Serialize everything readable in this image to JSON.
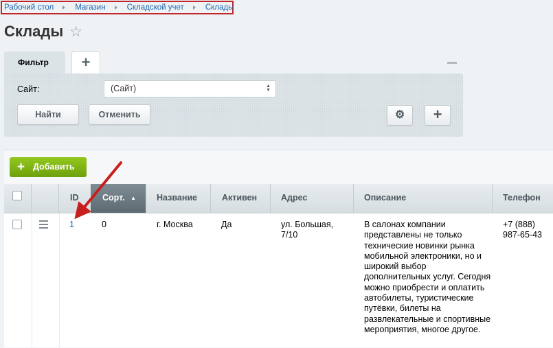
{
  "breadcrumb": [
    "Рабочий стол",
    "Магазин",
    "Складской учет",
    "Склады"
  ],
  "page_title": "Склады",
  "filter": {
    "tab_label": "Фильтр",
    "site_label": "Сайт:",
    "site_value": "(Сайт)",
    "find_button": "Найти",
    "cancel_button": "Отменить"
  },
  "list": {
    "add_button": "Добавить",
    "columns": [
      "ID",
      "Сорт.",
      "Название",
      "Активен",
      "Адрес",
      "Описание",
      "Телефон"
    ],
    "sorted_column": "Сорт.",
    "rows": [
      {
        "id": "1",
        "sort": "0",
        "name": "г. Москва",
        "active": "Да",
        "address": "ул. Большая, 7/10",
        "description": "В салонах компании представлены не только технические новинки рынка мобильной электроники, но и широкий выбор дополнительных услуг. Сегодня можно приобрести и оплатить автобилеты, туристические путёвки, билеты на развлекательные и спортивные мероприятия, многое другое.",
        "phone": "+7 (888) 987-65-43"
      }
    ]
  },
  "colors": {
    "breadcrumb_highlight": "#c0262c",
    "annotation_arrow": "#c81e1e",
    "add_button": "#7cb212",
    "link": "#2067b0"
  }
}
